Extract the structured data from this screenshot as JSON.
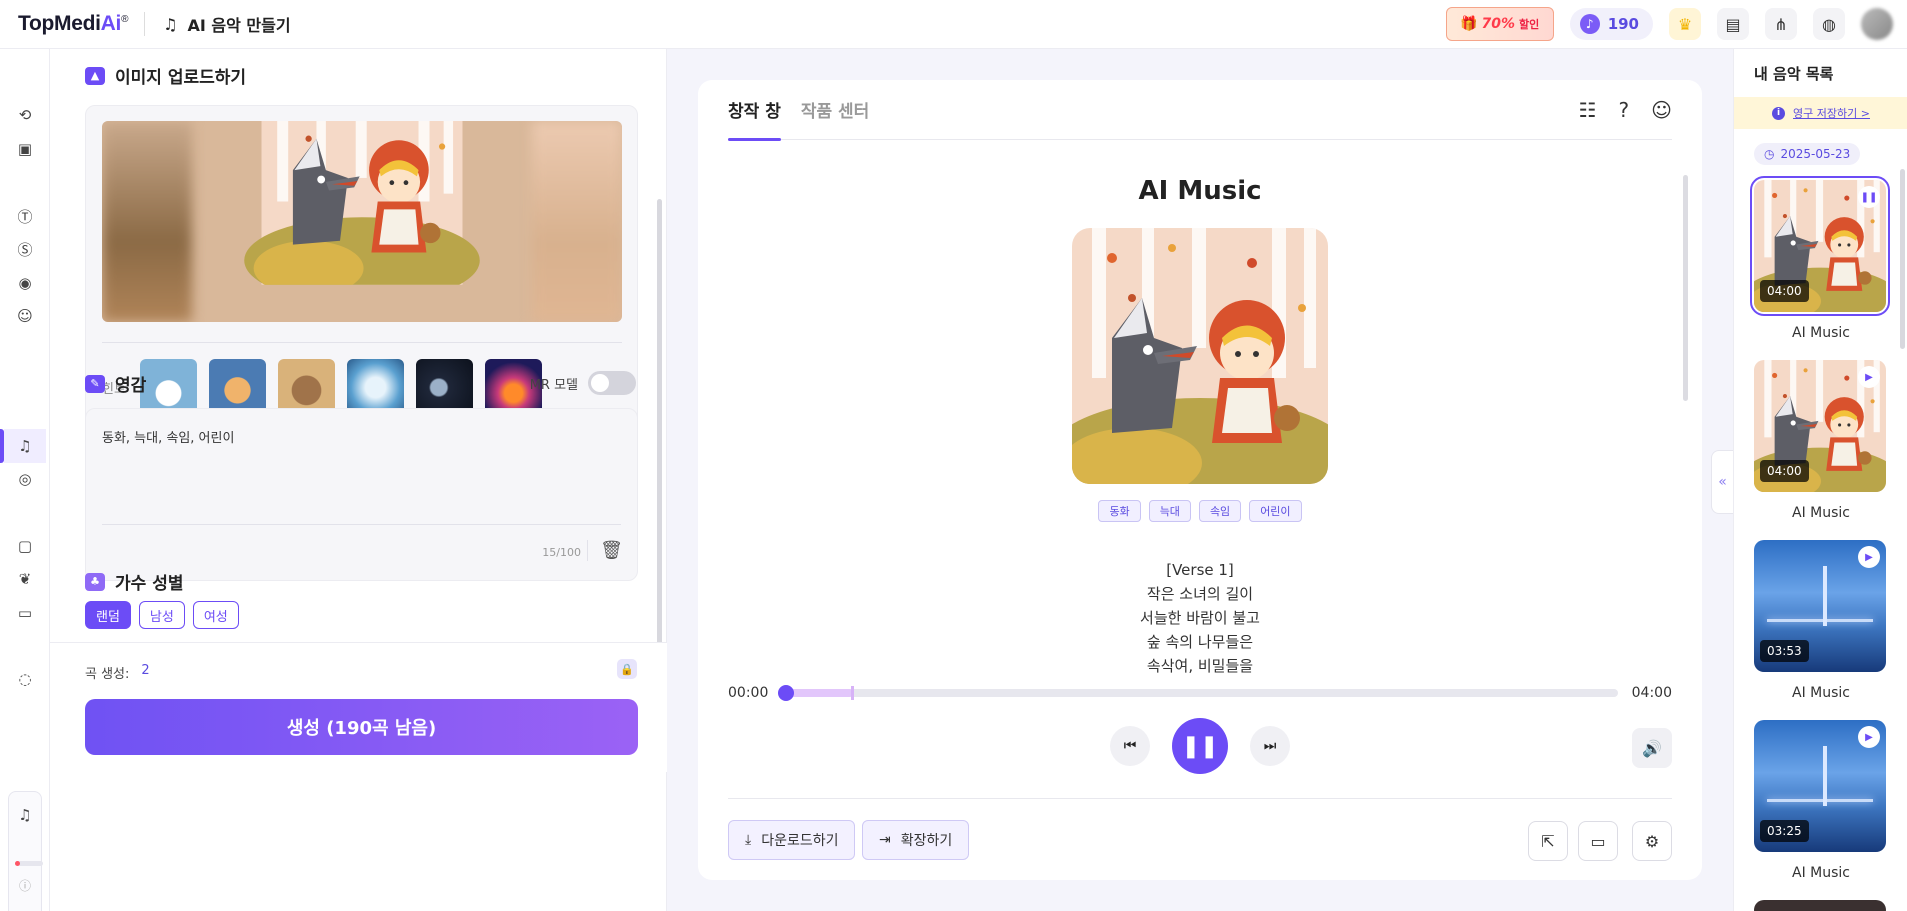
{
  "app": {
    "logo_prefix": "TopMedi",
    "logo_ai": "Ai",
    "logo_mark": "®",
    "page_title": "AI 음악 만들기"
  },
  "topbar": {
    "promo_percent": "70%",
    "promo_label": "할인",
    "credits": "190"
  },
  "upload": {
    "title": "이미지 업로드하기",
    "hint_label": "힌트",
    "thumbnails": [
      {
        "icon": "duck-thumbnail",
        "color": "#7fb3d8"
      },
      {
        "icon": "cat-thumbnail",
        "color": "#c98b55"
      },
      {
        "icon": "bear-thumbnail",
        "color": "#9a6b45"
      },
      {
        "icon": "girl-thumbnail",
        "color": "#8ec7e0"
      },
      {
        "icon": "planet-thumbnail",
        "color": "#2a3550"
      },
      {
        "icon": "fire-thumbnail",
        "color": "#3a2a80"
      }
    ]
  },
  "inspiration": {
    "title": "영감",
    "mr_label": "MR 모델",
    "mr_enabled": false,
    "text": "동화, 늑대, 속임, 어린이",
    "counter": "15/100"
  },
  "gender": {
    "title": "가수 성별",
    "options": [
      "랜덤",
      "남성",
      "여성"
    ],
    "selected": "랜덤"
  },
  "generate": {
    "count_label": "곡 생성:",
    "count_value": "2",
    "button_label": "생성 (190곡 남음)"
  },
  "main": {
    "tabs": [
      "창작 창",
      "작품 센터"
    ],
    "active_tab": "창작 창",
    "song_title": "AI Music",
    "tags": [
      "동화",
      "늑대",
      "속임",
      "어린이"
    ],
    "lyrics": [
      "[Verse 1]",
      "작은 소녀의 길이",
      "서늘한 바람이 불고",
      "숲 속의 나무들은",
      "속삭여, 비밀들을"
    ],
    "time_current": "00:00",
    "time_total": "04:00",
    "progress": 0.0,
    "buffered": 0.085,
    "download_label": "다운로드하기",
    "extend_label": "확장하기"
  },
  "sidebar_right": {
    "title": "내 음악 목록",
    "banner": "영구 저장하기 >",
    "date": "2025-05-23",
    "songs": [
      {
        "label": "AI Music",
        "duration": "04:00",
        "art": "fairytale",
        "state": "playing"
      },
      {
        "label": "AI Music",
        "duration": "04:00",
        "art": "fairytale",
        "state": "paused"
      },
      {
        "label": "AI Music",
        "duration": "03:53",
        "art": "bridge",
        "state": "paused"
      },
      {
        "label": "AI Music",
        "duration": "03:25",
        "art": "bridge",
        "state": "paused"
      }
    ]
  },
  "colors": {
    "accent": "#6c4cf6",
    "accent_light": "#f1efff",
    "promo_red": "#ff3b4a"
  }
}
